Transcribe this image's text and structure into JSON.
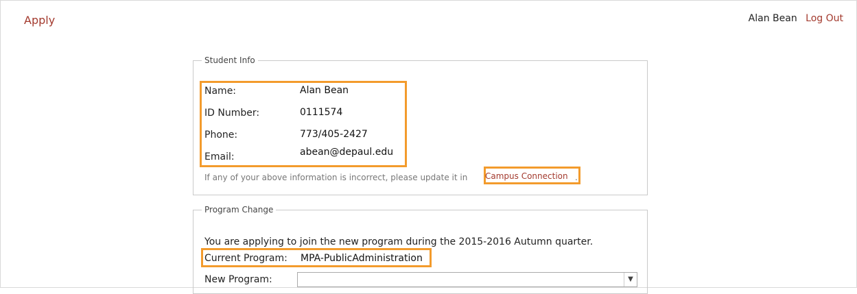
{
  "header": {
    "apply_label": "Apply",
    "user_name": "Alan Bean",
    "logout_label": "Log Out"
  },
  "student_info": {
    "legend": "Student Info",
    "name_label": "Name:",
    "name_value": "Alan Bean",
    "id_label": "ID Number:",
    "id_value": "0111574",
    "phone_label": "Phone:",
    "phone_value": "773/405-2427",
    "email_label": "Email:",
    "email_value": "abean@depaul.edu",
    "note": "If any of your above information is incorrect, please update it in",
    "campus_link": "Campus Connection",
    "period": "."
  },
  "program_change": {
    "legend": "Program Change",
    "intro": "You are applying to join the new program during the 2015-2016 Autumn quarter.",
    "current_label": "Current Program:",
    "current_value": "MPA-PublicAdministration",
    "new_label": "New Program:",
    "new_value": ""
  },
  "colors": {
    "accent": "#a33a2e",
    "highlight": "#f39b2c"
  },
  "icons": {
    "dropdown": "chevron-down-icon"
  }
}
